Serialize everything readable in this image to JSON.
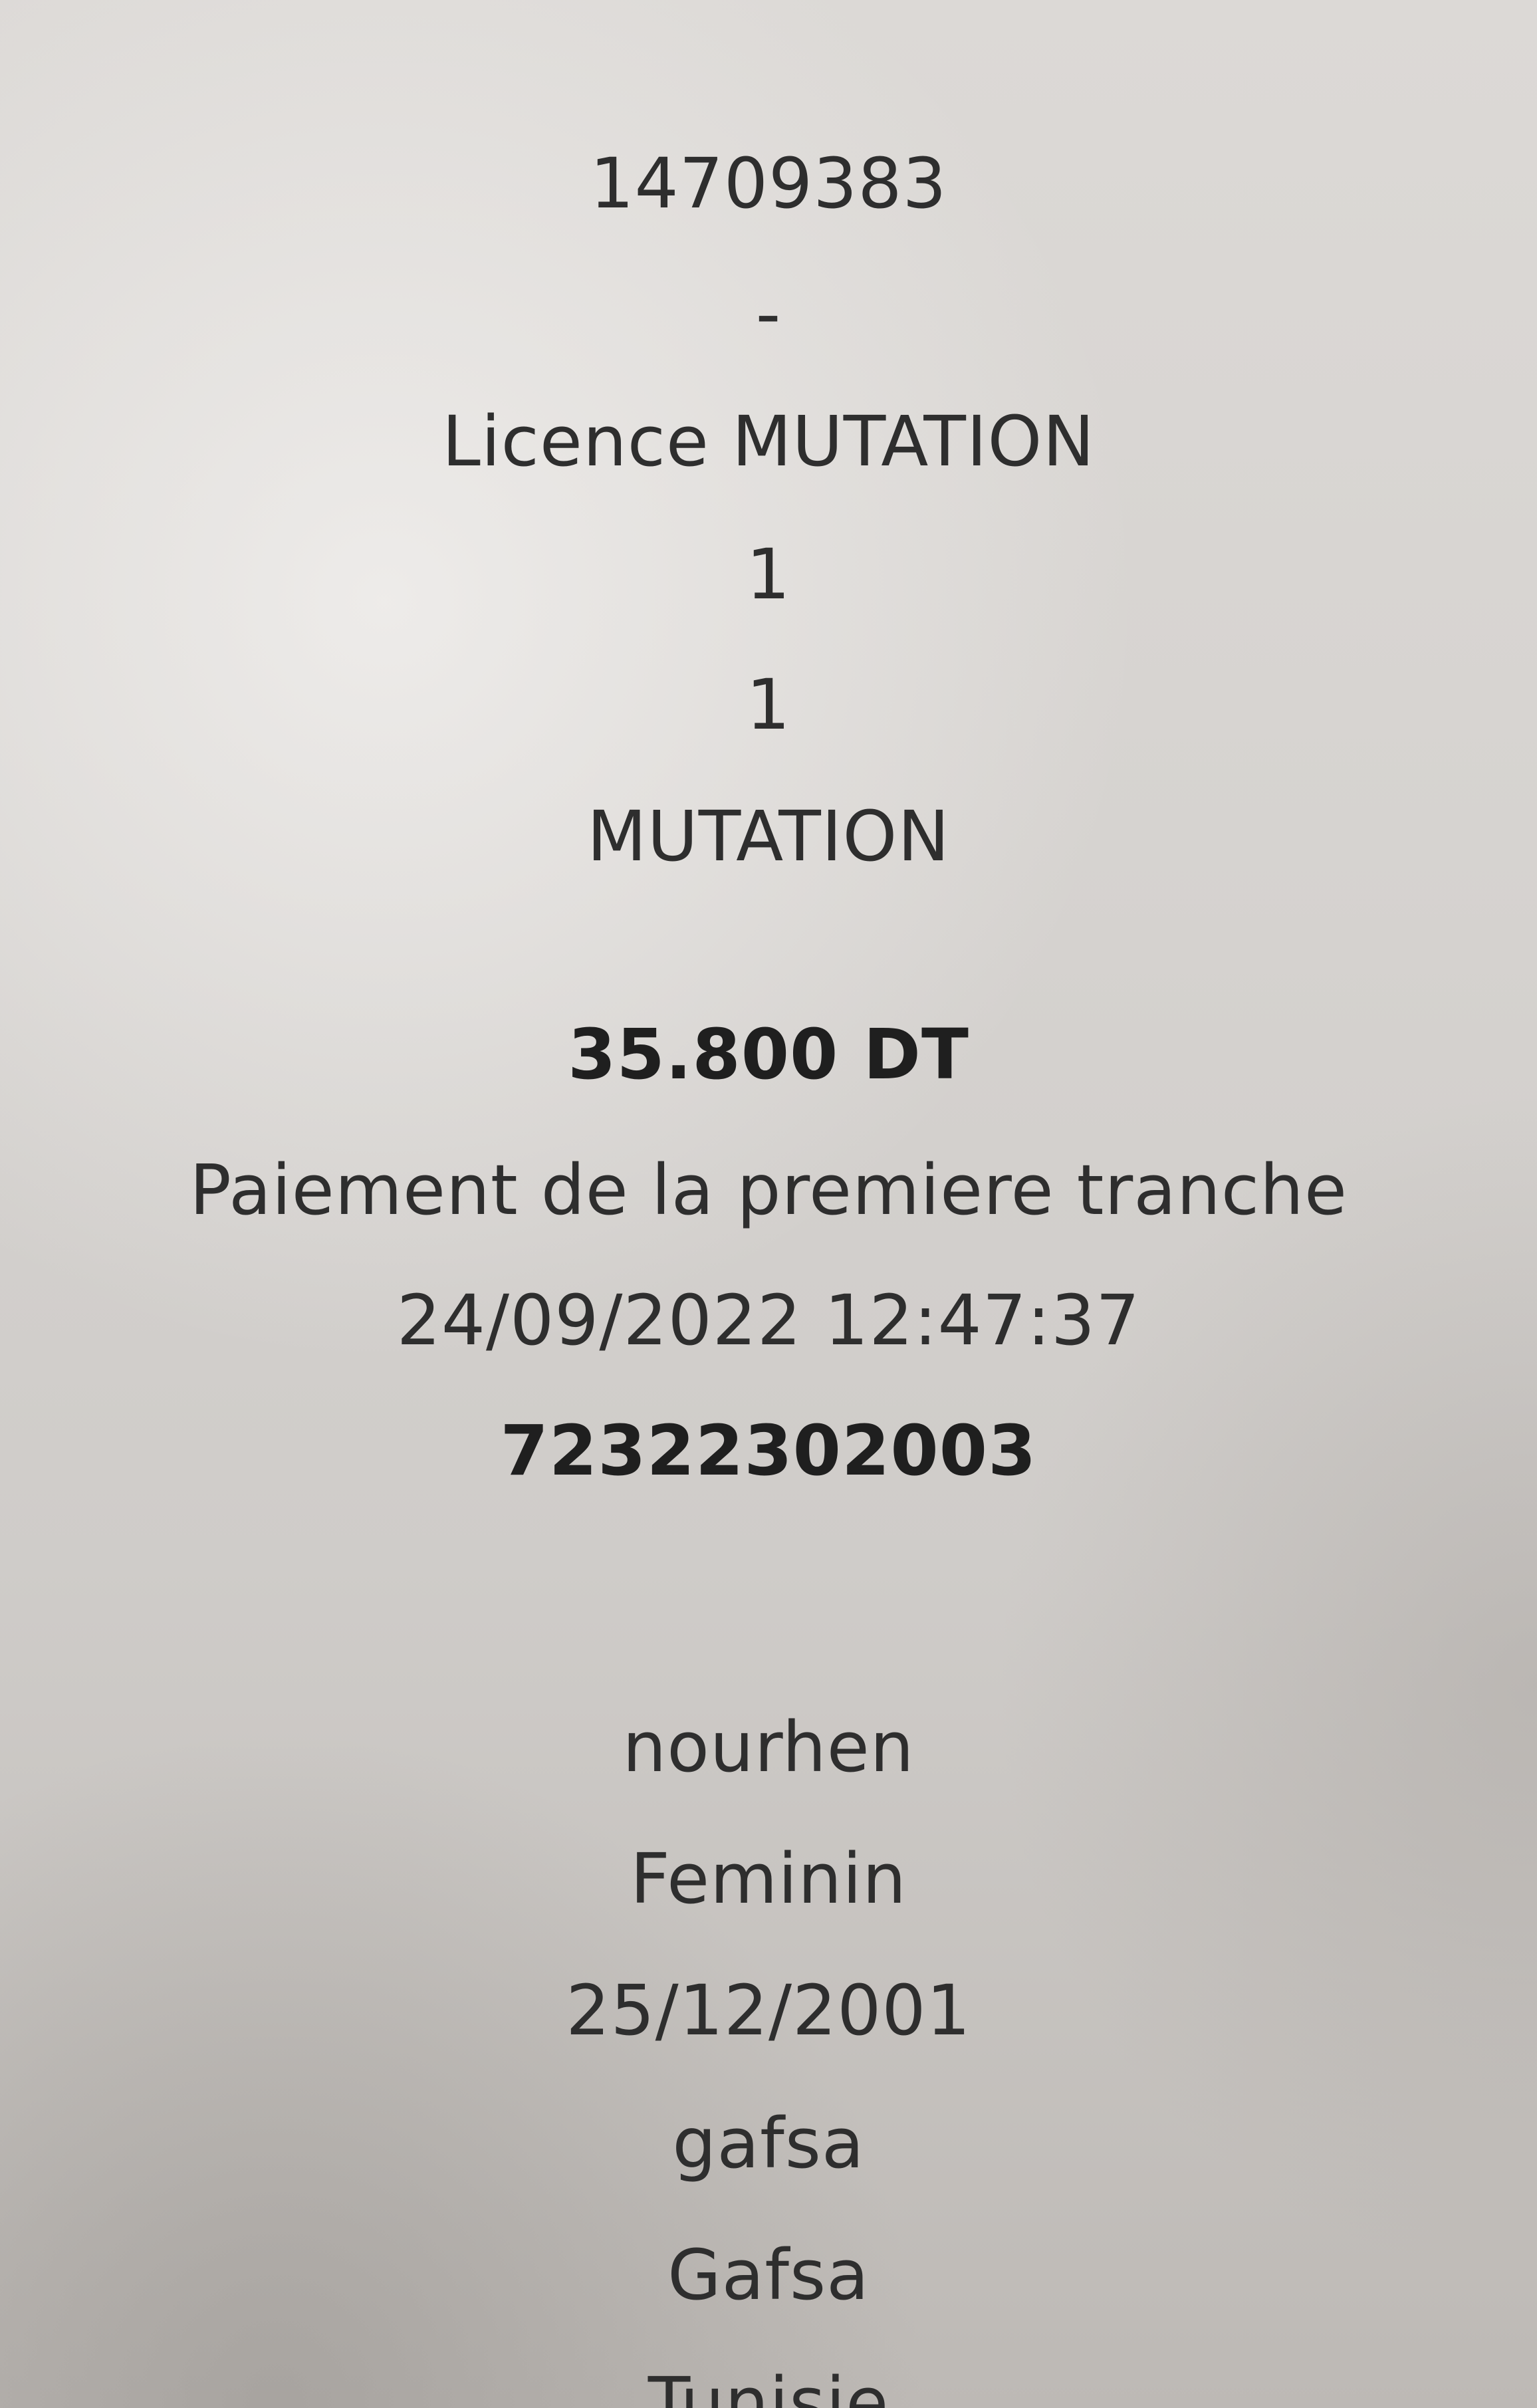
{
  "receipt": {
    "reference": "14709383",
    "separator": "-",
    "licence_type": "Licence MUTATION",
    "line_1": "1",
    "line_2": "1",
    "category": "MUTATION",
    "amount": "35.800 DT",
    "payment_description": "Paiement de la premiere tranche",
    "datetime": "24/09/2022 12:47:37",
    "transaction_number": "72322302003"
  },
  "person": {
    "first_name": "nourhen",
    "gender": "Feminin",
    "birth_date": "25/12/2001",
    "birth_place": "gafsa",
    "governorate": "Gafsa",
    "country": "Tunisie"
  }
}
